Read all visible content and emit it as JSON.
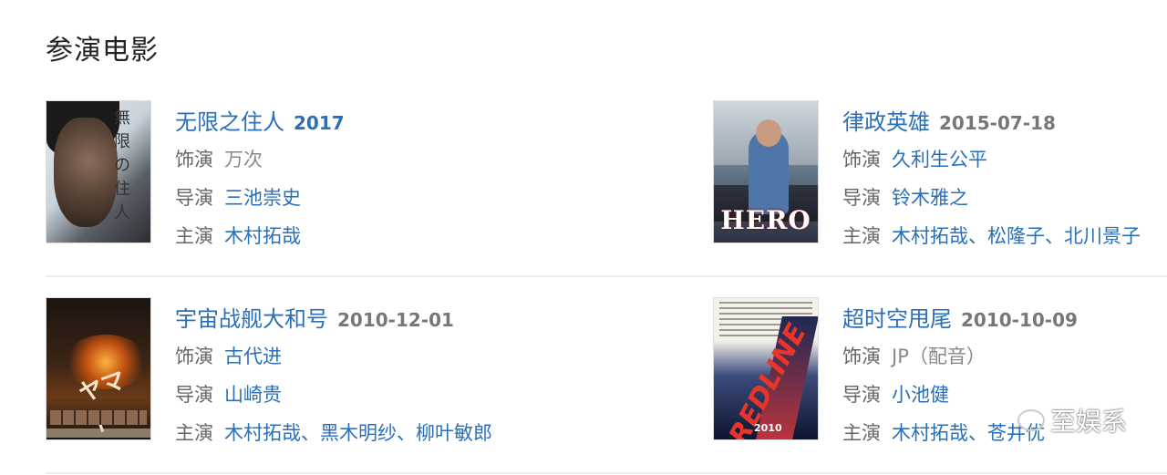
{
  "section": {
    "title": "参演电影"
  },
  "labels": {
    "role": "饰演",
    "director": "导演",
    "cast": "主演"
  },
  "movies": [
    {
      "title": "无限之住人",
      "date": "2017",
      "role": "万次",
      "director": "三池崇史",
      "cast": "木村拓哉",
      "poster_icon": "poster-blade-of-the-immortal"
    },
    {
      "title": "律政英雄",
      "date": "2015-07-18",
      "role": "久利生公平",
      "director": "铃木雅之",
      "cast": "木村拓哉、松隆子、北川景子",
      "poster_icon": "poster-hero",
      "poster_text": "HERO"
    },
    {
      "title": "宇宙战舰大和号",
      "date": "2010-12-01",
      "role": "古代进",
      "director": "山崎贵",
      "cast": "木村拓哉、黑木明纱、柳叶敏郎",
      "poster_icon": "poster-space-battleship-yamato"
    },
    {
      "title": "超时空甩尾",
      "date": "2010-10-09",
      "role": "JP（配音）",
      "director": "小池健",
      "cast": "木村拓哉、苍井优",
      "poster_icon": "poster-redline"
    }
  ],
  "watermark": {
    "text": "至娱系"
  }
}
